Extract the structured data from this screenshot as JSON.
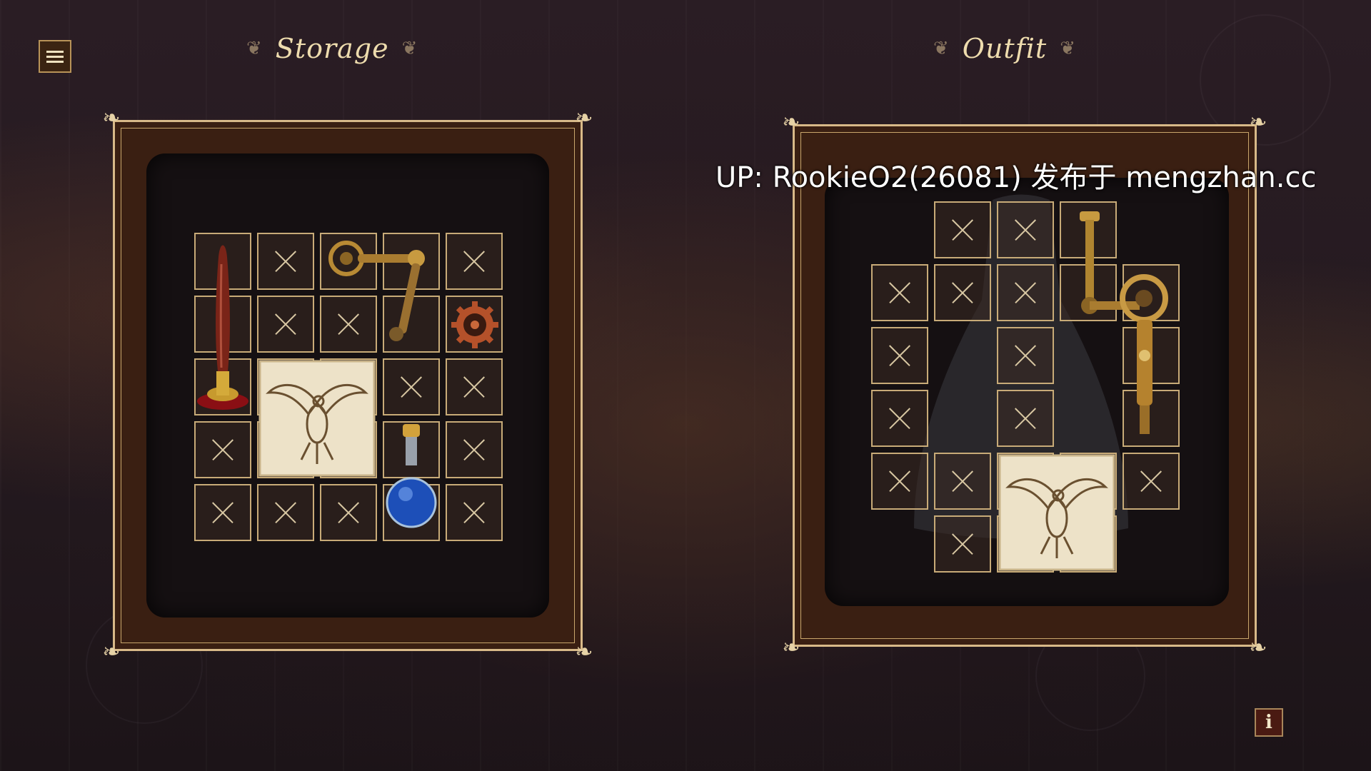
{
  "menu": {
    "icon": "hamburger-menu-icon"
  },
  "storage": {
    "title": "Storage"
  },
  "outfit": {
    "title": "Outfit"
  },
  "watermark": "UP: RookieO2(26081) 发布于 mengzhan.cc",
  "info": {
    "label": "i"
  },
  "storage_items": [
    "wax-seal-stamp",
    "steampunk-key-rod",
    "cog-gear",
    "eagle-parchment-card",
    "blue-potion-flask"
  ],
  "outfit_items": [
    "steampunk-mechanical-arm",
    "eagle-parchment-card"
  ],
  "colors": {
    "frame_gold": "#d8b988",
    "slot_border": "#c8ab78",
    "panel_brown": "#3a1f12",
    "title_cream": "#eedcae"
  }
}
